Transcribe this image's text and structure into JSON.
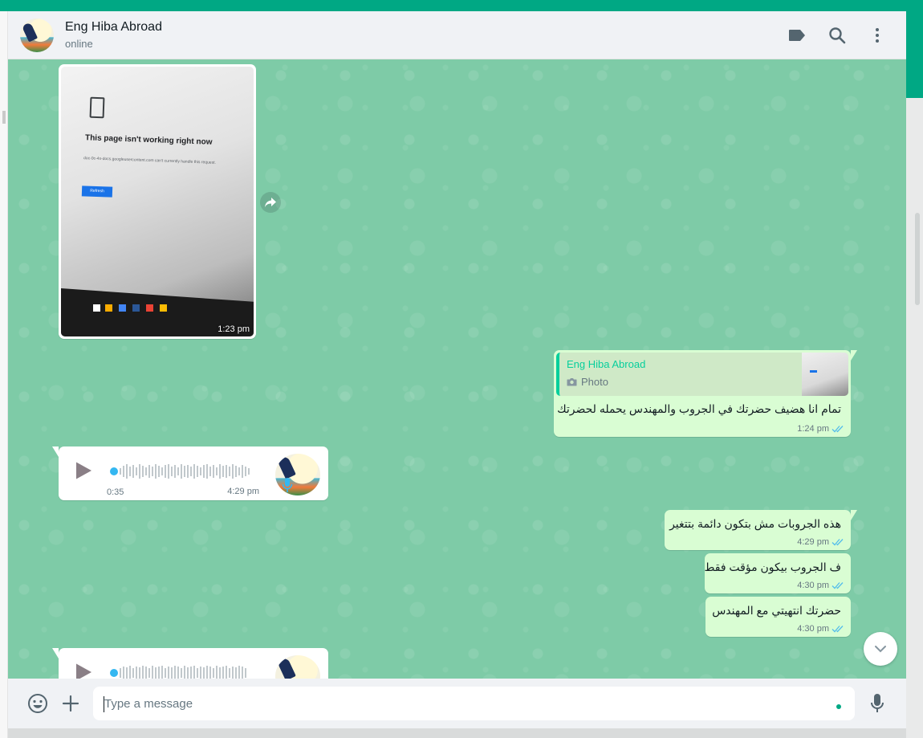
{
  "header": {
    "contact_name": "Eng Hiba Abroad",
    "status": "online",
    "icons": [
      "label-icon",
      "search-icon",
      "menu-icon"
    ]
  },
  "messages": {
    "photo": {
      "time": "1:23 pm",
      "page_title": "This page isn't working right now",
      "page_sub": "doc-0c-4s-docs.googleusercontent.com can't currently handle this request.",
      "page_btn": "Refresh"
    },
    "reply": {
      "quoted_name": "Eng Hiba Abroad",
      "quoted_type": "Photo",
      "text": "تمام انا هضيف حضرتك في الجروب والمهندس يحمله لحضرتك",
      "time": "1:24 pm"
    },
    "voice1": {
      "duration": "0:35",
      "time": "4:29 pm"
    },
    "text1": {
      "text": "هذه الجروبات مش بتكون دائمة بتتغير",
      "time": "4:29 pm"
    },
    "text2": {
      "text": "ف الجروب بيكون مؤقت فقط",
      "time": "4:30 pm"
    },
    "text3": {
      "text": "حضرتك انتهيتي مع المهندس",
      "time": "4:30 pm"
    }
  },
  "composer": {
    "placeholder": "Type a message",
    "icons": [
      "emoji-icon",
      "attach-icon",
      "mic-icon"
    ]
  },
  "colors": {
    "accent": "#00a884",
    "chat_bg": "#7ecba7",
    "outgoing": "#d9fdd3",
    "incoming": "#ffffff",
    "read_ticks": "#53bdeb"
  }
}
